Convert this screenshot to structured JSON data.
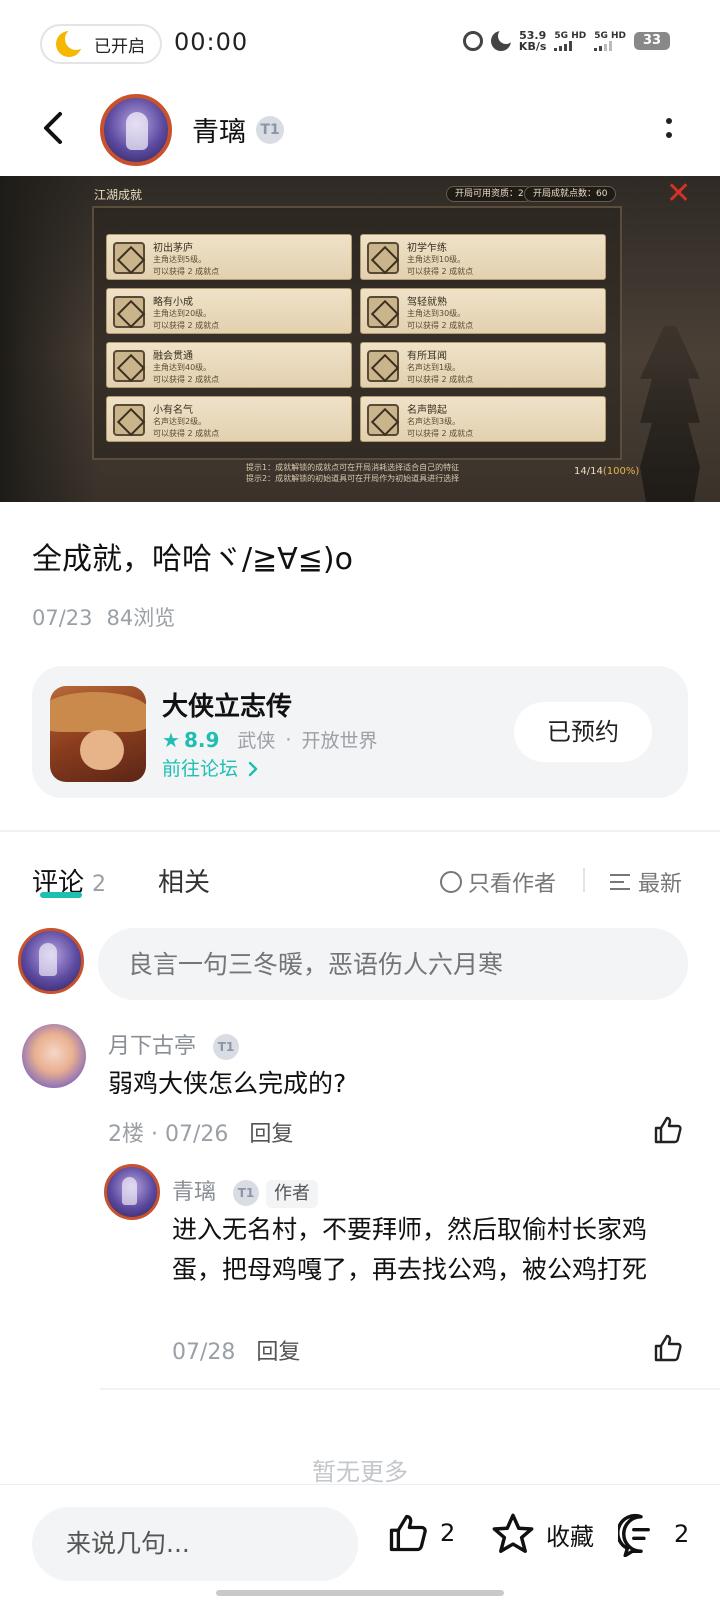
{
  "status_bar": {
    "mode_text": "已开启",
    "time": "00:00",
    "net_speed_value": "53.9",
    "net_speed_unit": "KB/s",
    "sim1": "5G HD",
    "sim2": "5G HD",
    "battery": "33"
  },
  "header": {
    "username": "青璃",
    "level_badge": "T1"
  },
  "game_screenshot": {
    "panel_title": "江湖成就",
    "resource_label": "开局可用资质：2",
    "points_label": "开局成就点数：60",
    "achievements": [
      {
        "name": "初出茅庐",
        "desc": "主角达到5级。",
        "reward": "可以获得 2 成就点"
      },
      {
        "name": "初学乍练",
        "desc": "主角达到10级。",
        "reward": "可以获得 2 成就点"
      },
      {
        "name": "略有小成",
        "desc": "主角达到20级。",
        "reward": "可以获得 2 成就点"
      },
      {
        "name": "驾轻就熟",
        "desc": "主角达到30级。",
        "reward": "可以获得 2 成就点"
      },
      {
        "name": "融会贯通",
        "desc": "主角达到40级。",
        "reward": "可以获得 2 成就点"
      },
      {
        "name": "有所耳闻",
        "desc": "名声达到1级。",
        "reward": "可以获得 2 成就点"
      },
      {
        "name": "小有名气",
        "desc": "名声达到2级。",
        "reward": "可以获得 2 成就点"
      },
      {
        "name": "名声鹊起",
        "desc": "名声达到3级。",
        "reward": "可以获得 2 成就点"
      }
    ],
    "tip1": "提示1：成就解锁的成就点可在开局消耗选择适合自己的特征",
    "tip2": "提示2：成就解锁的初始道具可在开局作为初始道具进行选择",
    "progress_count": "14/14",
    "progress_pct": "(100%)"
  },
  "post": {
    "title": "全成就，哈哈ヾ/≧∀≦)o",
    "date": "07/23",
    "views": "84浏览"
  },
  "game_card": {
    "name": "大侠立志传",
    "rating": "8.9",
    "tag1": "武侠",
    "tag2": "开放世界",
    "forum_link": "前往论坛",
    "reserve_button": "已预约"
  },
  "tabs": {
    "comments_label": "评论",
    "comments_count": "2",
    "related_label": "相关",
    "only_author": "只看作者",
    "sort_label": "最新"
  },
  "comment_input": {
    "placeholder": "良言一句三冬暖，恶语伤人六月寒"
  },
  "comments": [
    {
      "user": "月下古亭",
      "badge": "T1",
      "text": "弱鸡大侠怎么完成的?",
      "floor": "2楼",
      "date": "07/26",
      "reply_label": "回复"
    }
  ],
  "reply": {
    "user": "青璃",
    "badge": "T1",
    "author_tag": "作者",
    "text": "进入无名村，不要拜师，然后取偷村长家鸡蛋，把母鸡嘎了，再去找公鸡，被公鸡打死",
    "date": "07/28",
    "reply_label": "回复"
  },
  "no_more": "暂无更多",
  "bottom_bar": {
    "input_placeholder": "来说几句...",
    "like_count": "2",
    "favorite_label": "收藏",
    "comment_count": "2"
  },
  "colors": {
    "accent": "#1ebfb2",
    "text_primary": "#111111",
    "text_secondary": "#9aa0a6",
    "card_bg": "#f3f4f6"
  }
}
